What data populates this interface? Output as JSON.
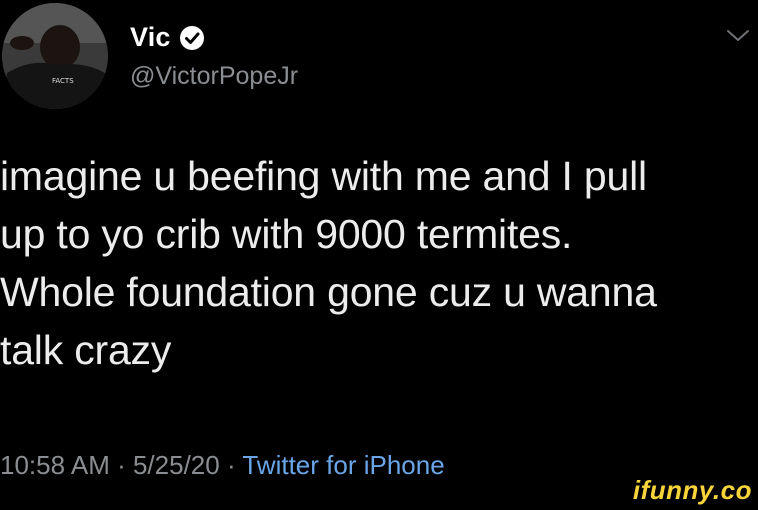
{
  "author": {
    "display_name": "Vic",
    "handle": "@VictorPopeJr",
    "verified": true,
    "avatar_shirt_text": "FACTS"
  },
  "tweet": {
    "text": "imagine u beefing with me and I pull\nup to yo crib with 9000 termites.\nWhole foundation gone cuz u wanna\ntalk crazy",
    "time": "10:58 AM",
    "separator": " · ",
    "date": "5/25/20",
    "source": "Twitter for iPhone"
  },
  "icons": {
    "verified": "verified-badge-icon",
    "menu": "chevron-down-icon"
  },
  "watermark": "ifunny.co",
  "colors": {
    "background": "#000000",
    "text": "#ececec",
    "muted": "#8a8d91",
    "link": "#6aa5e8",
    "watermark": "#f7d43a"
  }
}
